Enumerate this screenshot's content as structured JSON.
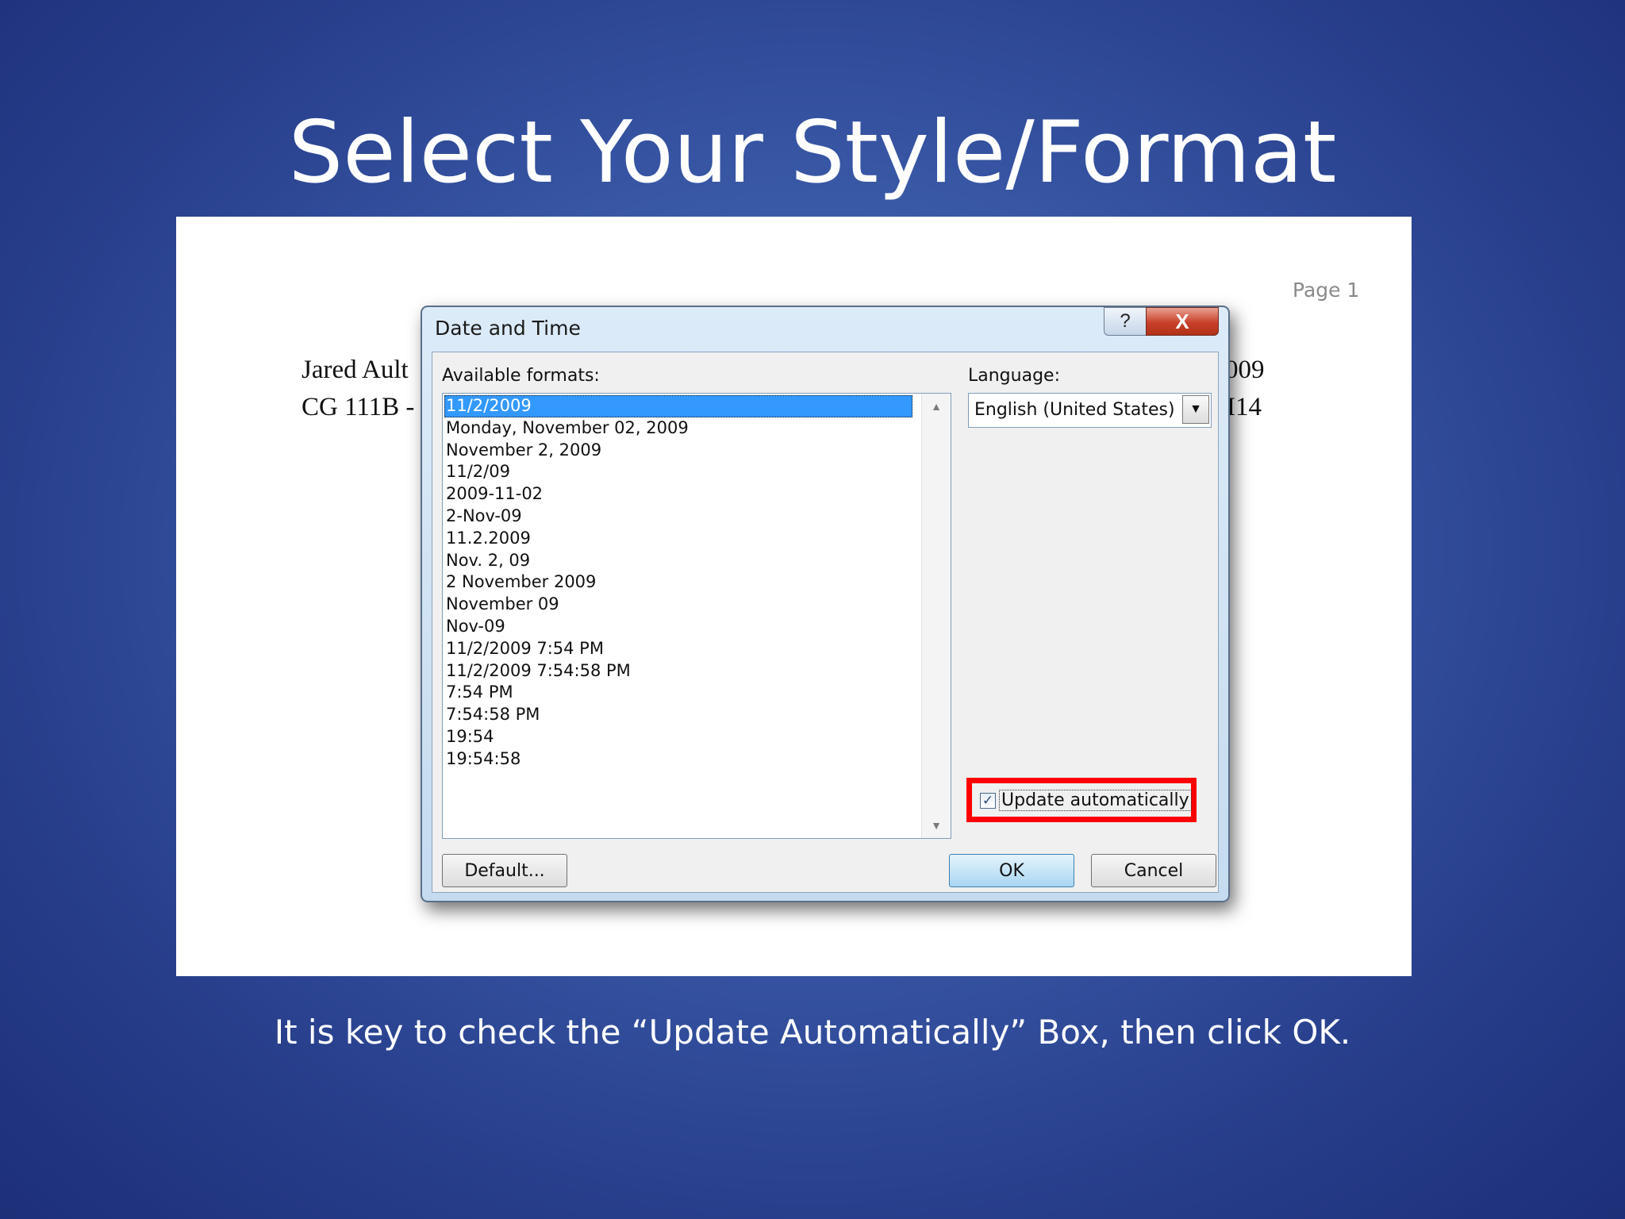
{
  "slide": {
    "title": "Select Your Style/Format",
    "caption": "It is key to check the “Update Automatically” Box, then click OK."
  },
  "document": {
    "page_label": "Page 1",
    "left_line1": "Jared Ault",
    "left_line2": "CG 111B -",
    "right_line1": "009",
    "right_line2": "I14"
  },
  "dialog": {
    "title": "Date and Time",
    "help_glyph": "?",
    "close_glyph": "X",
    "available_formats_label": "Available formats:",
    "formats": [
      "11/2/2009",
      "Monday, November 02, 2009",
      "November 2, 2009",
      "11/2/09",
      "2009-11-02",
      "2-Nov-09",
      "11.2.2009",
      "Nov. 2, 09",
      "2 November 2009",
      "November 09",
      "Nov-09",
      "11/2/2009 7:54 PM",
      "11/2/2009 7:54:58 PM",
      "7:54 PM",
      "7:54:58 PM",
      "19:54",
      "19:54:58"
    ],
    "selected_format": "11/2/2009",
    "language_label": "Language:",
    "language_value": "English (United States)",
    "update_automatically_label": "Update automatically",
    "update_automatically_checked": true,
    "default_button": "Default...",
    "ok_button": "OK",
    "cancel_button": "Cancel",
    "highlight_color": "#ff0000",
    "selection_color": "#3399ff"
  }
}
